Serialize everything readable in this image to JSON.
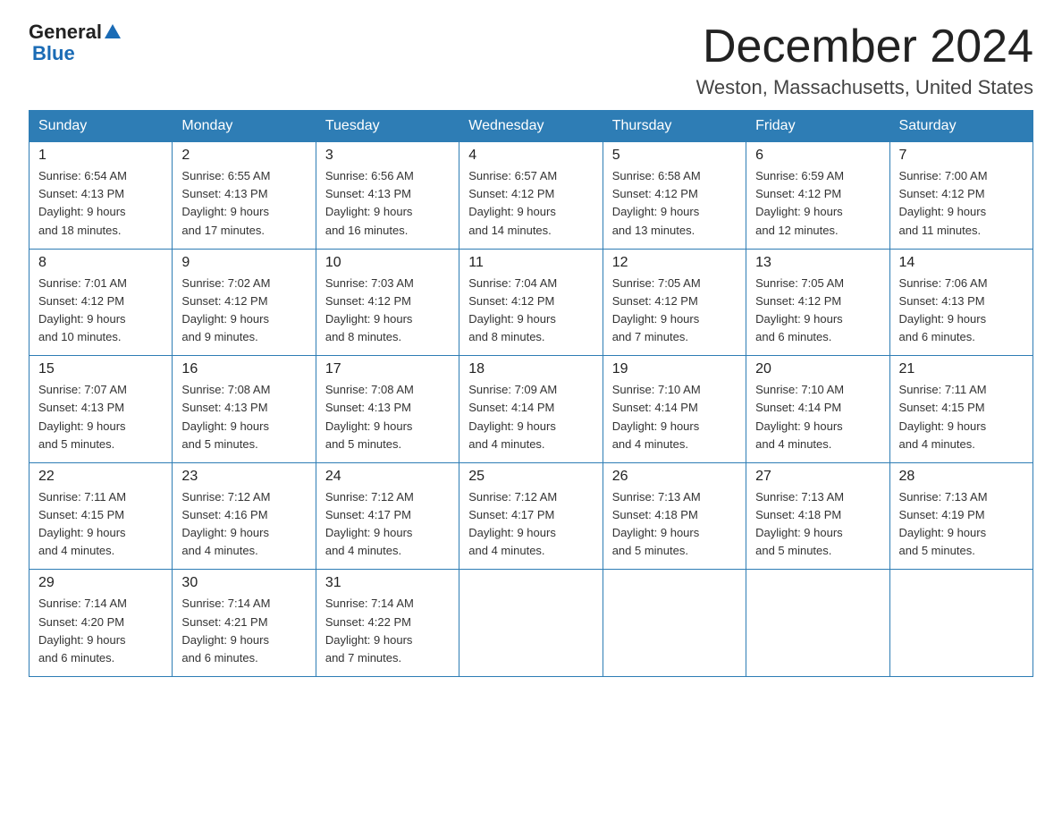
{
  "header": {
    "logo_general": "General",
    "logo_blue": "Blue",
    "month": "December 2024",
    "location": "Weston, Massachusetts, United States"
  },
  "days_of_week": [
    "Sunday",
    "Monday",
    "Tuesday",
    "Wednesday",
    "Thursday",
    "Friday",
    "Saturday"
  ],
  "weeks": [
    [
      {
        "day": "1",
        "sunrise": "6:54 AM",
        "sunset": "4:13 PM",
        "daylight": "9 hours and 18 minutes."
      },
      {
        "day": "2",
        "sunrise": "6:55 AM",
        "sunset": "4:13 PM",
        "daylight": "9 hours and 17 minutes."
      },
      {
        "day": "3",
        "sunrise": "6:56 AM",
        "sunset": "4:13 PM",
        "daylight": "9 hours and 16 minutes."
      },
      {
        "day": "4",
        "sunrise": "6:57 AM",
        "sunset": "4:12 PM",
        "daylight": "9 hours and 14 minutes."
      },
      {
        "day": "5",
        "sunrise": "6:58 AM",
        "sunset": "4:12 PM",
        "daylight": "9 hours and 13 minutes."
      },
      {
        "day": "6",
        "sunrise": "6:59 AM",
        "sunset": "4:12 PM",
        "daylight": "9 hours and 12 minutes."
      },
      {
        "day": "7",
        "sunrise": "7:00 AM",
        "sunset": "4:12 PM",
        "daylight": "9 hours and 11 minutes."
      }
    ],
    [
      {
        "day": "8",
        "sunrise": "7:01 AM",
        "sunset": "4:12 PM",
        "daylight": "9 hours and 10 minutes."
      },
      {
        "day": "9",
        "sunrise": "7:02 AM",
        "sunset": "4:12 PM",
        "daylight": "9 hours and 9 minutes."
      },
      {
        "day": "10",
        "sunrise": "7:03 AM",
        "sunset": "4:12 PM",
        "daylight": "9 hours and 8 minutes."
      },
      {
        "day": "11",
        "sunrise": "7:04 AM",
        "sunset": "4:12 PM",
        "daylight": "9 hours and 8 minutes."
      },
      {
        "day": "12",
        "sunrise": "7:05 AM",
        "sunset": "4:12 PM",
        "daylight": "9 hours and 7 minutes."
      },
      {
        "day": "13",
        "sunrise": "7:05 AM",
        "sunset": "4:12 PM",
        "daylight": "9 hours and 6 minutes."
      },
      {
        "day": "14",
        "sunrise": "7:06 AM",
        "sunset": "4:13 PM",
        "daylight": "9 hours and 6 minutes."
      }
    ],
    [
      {
        "day": "15",
        "sunrise": "7:07 AM",
        "sunset": "4:13 PM",
        "daylight": "9 hours and 5 minutes."
      },
      {
        "day": "16",
        "sunrise": "7:08 AM",
        "sunset": "4:13 PM",
        "daylight": "9 hours and 5 minutes."
      },
      {
        "day": "17",
        "sunrise": "7:08 AM",
        "sunset": "4:13 PM",
        "daylight": "9 hours and 5 minutes."
      },
      {
        "day": "18",
        "sunrise": "7:09 AM",
        "sunset": "4:14 PM",
        "daylight": "9 hours and 4 minutes."
      },
      {
        "day": "19",
        "sunrise": "7:10 AM",
        "sunset": "4:14 PM",
        "daylight": "9 hours and 4 minutes."
      },
      {
        "day": "20",
        "sunrise": "7:10 AM",
        "sunset": "4:14 PM",
        "daylight": "9 hours and 4 minutes."
      },
      {
        "day": "21",
        "sunrise": "7:11 AM",
        "sunset": "4:15 PM",
        "daylight": "9 hours and 4 minutes."
      }
    ],
    [
      {
        "day": "22",
        "sunrise": "7:11 AM",
        "sunset": "4:15 PM",
        "daylight": "9 hours and 4 minutes."
      },
      {
        "day": "23",
        "sunrise": "7:12 AM",
        "sunset": "4:16 PM",
        "daylight": "9 hours and 4 minutes."
      },
      {
        "day": "24",
        "sunrise": "7:12 AM",
        "sunset": "4:17 PM",
        "daylight": "9 hours and 4 minutes."
      },
      {
        "day": "25",
        "sunrise": "7:12 AM",
        "sunset": "4:17 PM",
        "daylight": "9 hours and 4 minutes."
      },
      {
        "day": "26",
        "sunrise": "7:13 AM",
        "sunset": "4:18 PM",
        "daylight": "9 hours and 5 minutes."
      },
      {
        "day": "27",
        "sunrise": "7:13 AM",
        "sunset": "4:18 PM",
        "daylight": "9 hours and 5 minutes."
      },
      {
        "day": "28",
        "sunrise": "7:13 AM",
        "sunset": "4:19 PM",
        "daylight": "9 hours and 5 minutes."
      }
    ],
    [
      {
        "day": "29",
        "sunrise": "7:14 AM",
        "sunset": "4:20 PM",
        "daylight": "9 hours and 6 minutes."
      },
      {
        "day": "30",
        "sunrise": "7:14 AM",
        "sunset": "4:21 PM",
        "daylight": "9 hours and 6 minutes."
      },
      {
        "day": "31",
        "sunrise": "7:14 AM",
        "sunset": "4:22 PM",
        "daylight": "9 hours and 7 minutes."
      },
      null,
      null,
      null,
      null
    ]
  ],
  "labels": {
    "sunrise": "Sunrise:",
    "sunset": "Sunset:",
    "daylight": "Daylight:"
  }
}
